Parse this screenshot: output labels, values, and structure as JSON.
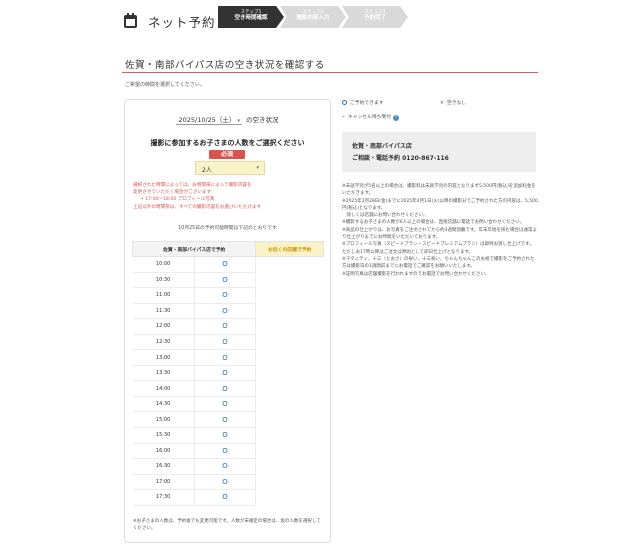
{
  "header": {
    "title": "ネット予約",
    "steps": [
      {
        "num": "ステップ1",
        "label": "空き時間確認"
      },
      {
        "num": "ステップ2",
        "label": "撮影内容入力"
      },
      {
        "num": "ステップ3",
        "label": "予約完了"
      }
    ]
  },
  "section": {
    "title": "佐賀・南部バイパス店の空き状況を確認する",
    "instruction": "ご希望の時間を選択してください。"
  },
  "availability": {
    "date_value": "2025/10/25（土）",
    "date_suffix": "の空き状況",
    "kids_heading": "撮影に参加するお子さまの人数をご選択ください",
    "required_label": "必須",
    "kids_value": "2人",
    "notice_lines": [
      "選択された時間によっては、お時間帯によって撮影内容を",
      "変更させていただく場合がございます",
      "17:00～18:00 プロフィール写真",
      "上記以外の時間帯は、すべての撮影内容をお選びいただけます"
    ],
    "available_note": "10月25日の予約可能時間は下記のとおりです",
    "table_headers": {
      "store": "佐賀・南部バイパス店で予約",
      "near": "お近くの店舗で予約"
    },
    "slots": [
      {
        "time": "10:00",
        "mark": "O"
      },
      {
        "time": "10:30",
        "mark": "O"
      },
      {
        "time": "11:00",
        "mark": "O"
      },
      {
        "time": "11:30",
        "mark": "O"
      },
      {
        "time": "12:00",
        "mark": "O"
      },
      {
        "time": "12:30",
        "mark": "O"
      },
      {
        "time": "13:00",
        "mark": "O"
      },
      {
        "time": "13:30",
        "mark": "O"
      },
      {
        "time": "14:00",
        "mark": "O"
      },
      {
        "time": "14:30",
        "mark": "O"
      },
      {
        "time": "15:00",
        "mark": "O"
      },
      {
        "time": "15:30",
        "mark": "O"
      },
      {
        "time": "16:00",
        "mark": "O"
      },
      {
        "time": "16:30",
        "mark": "O"
      },
      {
        "time": "17:00",
        "mark": "O"
      },
      {
        "time": "17:30",
        "mark": "O"
      }
    ],
    "footnote": "※お子さまの人数は、予約後でも変更可能です。人数が未確定の場合は、仮の人数を選択してください。"
  },
  "legend": {
    "available": "ご予約できます",
    "unavailable": "空きなし",
    "waitlist": "キャンセル待ち受付"
  },
  "store": {
    "name": "佐賀・南部バイパス店",
    "contact_label": "ご相談・電話予約",
    "phone": "0120-867-116"
  },
  "notes": [
    "※未就学児が5名以上の場合は、撮影料は未就学児の内容となりまず5,500円(税込)を追加料金をいただきます。",
    "※2025年2月28日(金)までに2025年4月1日(火)以降の撮影分でご予約された方の内容は、5,500円(税込)となります。",
    "　詳しくは店舗にお問い合わせください。",
    "※撮影するお子さまの人数が6人以上の場合は、直接店舗に電話でお問い合わせください。",
    "※商品の仕上がりは、お写真をご注文されてから約3週間頂戴です。年末年始を挟む場合は通常より仕上がりまでにお時間をいただいております。",
    "※プロフィール写真（スピードプラン・スピードプレミアムプラン）は即時お渡し仕上げです。ただしお17時以降はご注文は原則として即日仕上げとなります。",
    "※マタニティ、十三（とおさ）の祝い、十三祝い、ちゃんちゃんこのお祝で撮影をご予約された方は撮影日の1週間前までにお電話でご確認をお願いいたします。",
    "※証明写真は店舗撮影を行われますのでお電話でお問い合わせください。"
  ]
}
